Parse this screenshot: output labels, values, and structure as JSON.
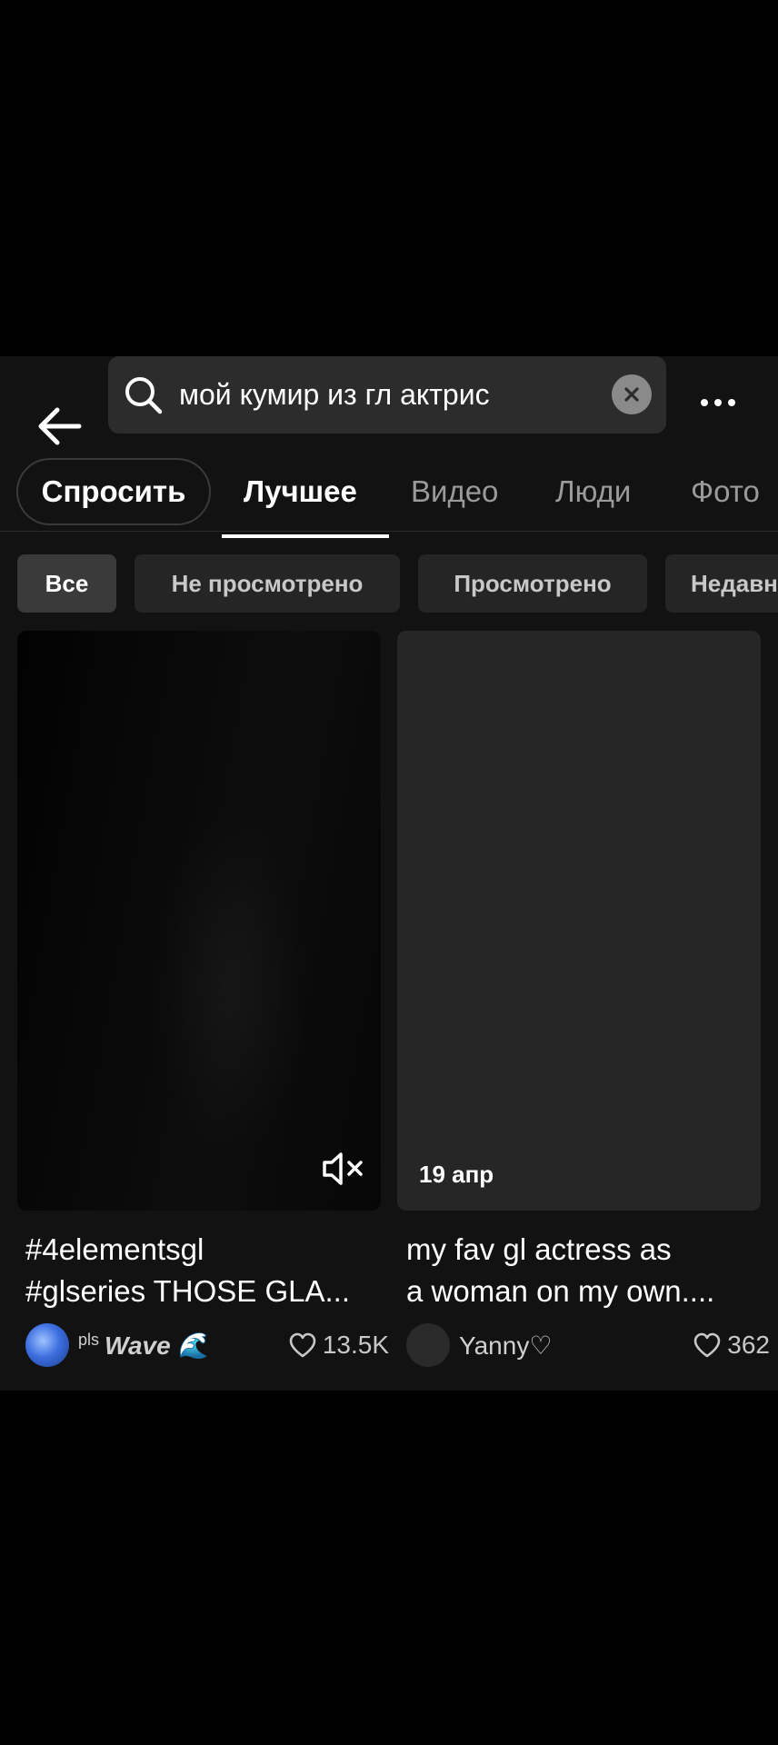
{
  "search": {
    "query": "мой кумир из гл актрис"
  },
  "tabs": [
    {
      "label": "Спросить"
    },
    {
      "label": "Лучшее"
    },
    {
      "label": "Видео"
    },
    {
      "label": "Люди"
    },
    {
      "label": "Фото"
    }
  ],
  "active_tab": "Лучшее",
  "filters": [
    {
      "label": "Все"
    },
    {
      "label": "Не просмотрено"
    },
    {
      "label": "Просмотрено"
    },
    {
      "label": "Недавн"
    }
  ],
  "active_filter": "Все",
  "videos": [
    {
      "caption_line1": "#4elementsgl",
      "caption_line2": "#glseries THOSE GLA...",
      "author_prefix": "pls",
      "author_name": "Wave 🌊",
      "likes": "13.5K"
    },
    {
      "date": "19 апр",
      "caption_line1": "my fav gl actress as",
      "caption_line2": "a woman on my own....",
      "author_name": "Yanny♡",
      "likes": "362"
    }
  ],
  "colors": {
    "background": "#121212",
    "search_bg": "#2c2c2c",
    "chip_bg": "#252525",
    "chip_active_bg": "#3a3a3a",
    "inactive_text": "#9a9a9a"
  }
}
